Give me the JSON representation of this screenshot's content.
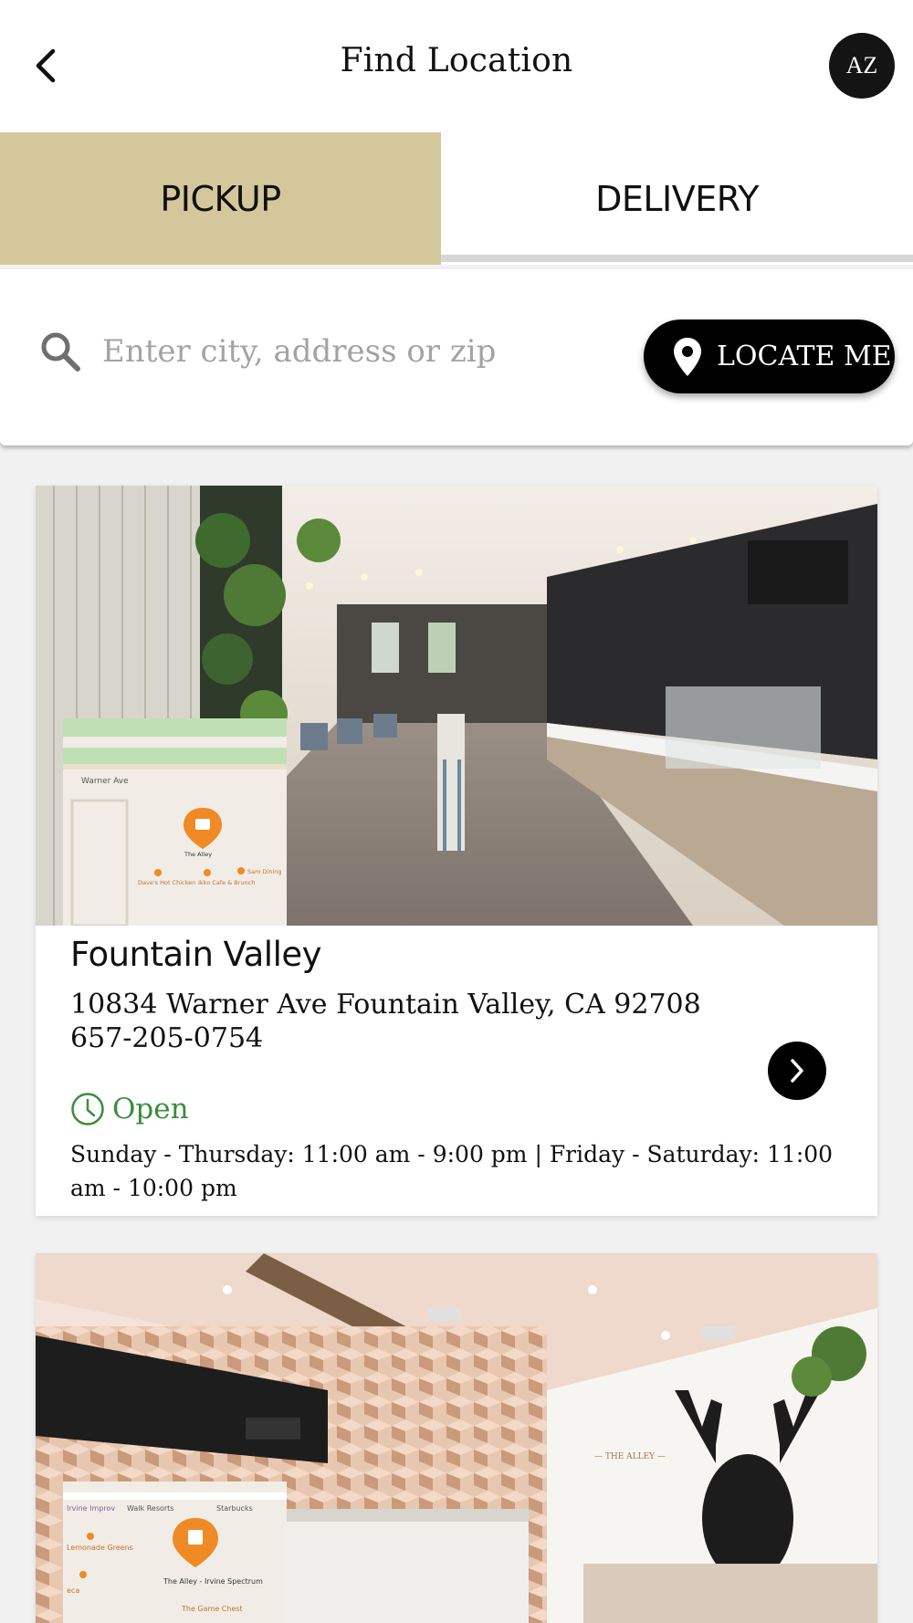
{
  "header": {
    "title": "Find Location",
    "avatar_initials": "AZ"
  },
  "tabs": [
    {
      "label": "PICKUP",
      "selected": true
    },
    {
      "label": "DELIVERY",
      "selected": false
    }
  ],
  "search": {
    "placeholder": "Enter city, address or zip",
    "value": "",
    "locate_label": "LOCATE ME"
  },
  "locations": [
    {
      "name": "Fountain Valley",
      "address": "10834 Warner Ave Fountain Valley, CA 92708",
      "phone": "657-205-0754",
      "status": "Open",
      "hours": "Sunday - Thursday: 11:00 am - 9:00 pm | Friday - Saturday: 11:00 am - 10:00 pm",
      "map_labels": [
        "Warner Ave",
        "The Alley",
        "Dave's Hot Chicken",
        "Ikko Cafe & Brunch",
        "Sam Dining"
      ]
    },
    {
      "name": "",
      "map_labels": [
        "Irvine Improv",
        "Walk Resorts",
        "Starbucks",
        "Lemonade Greens",
        "The Alley - Irvine Spectrum",
        "The Game Chest",
        "eca"
      ]
    }
  ],
  "colors": {
    "pickup_tab_bg": "#d4c79c",
    "open_green": "#3b8c3b",
    "button_black": "#000000",
    "map_pin_orange": "#f08a24"
  }
}
